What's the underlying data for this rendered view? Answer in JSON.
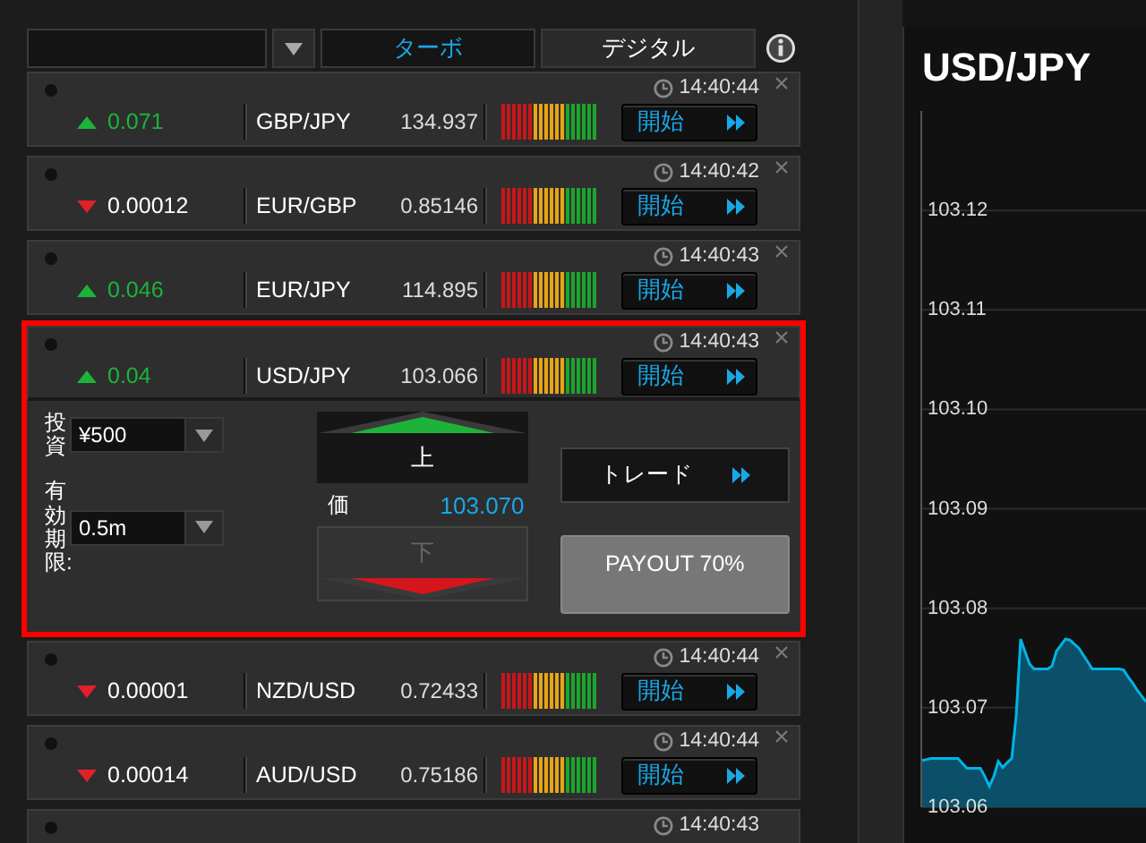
{
  "toolbar": {
    "tabs": [
      {
        "label": "ターボ",
        "selected": true
      },
      {
        "label": "デジタル",
        "selected": false
      }
    ]
  },
  "quotes": [
    {
      "kind": "quote",
      "rising": true,
      "change": "0.071",
      "pair": "GBP/JPY",
      "price": "134.937",
      "time": "14:40:44",
      "button": "開始",
      "expanded": false,
      "highlighted": false
    },
    {
      "kind": "quote",
      "rising": false,
      "change": "0.00012",
      "pair": "EUR/GBP",
      "price": "0.85146",
      "time": "14:40:42",
      "button": "開始",
      "expanded": false,
      "highlighted": false
    },
    {
      "kind": "quote",
      "rising": true,
      "change": "0.046",
      "pair": "EUR/JPY",
      "price": "114.895",
      "time": "14:40:43",
      "button": "開始",
      "expanded": false,
      "highlighted": false
    },
    {
      "kind": "quote",
      "rising": true,
      "change": "0.04",
      "pair": "USD/JPY",
      "price": "103.066",
      "time": "14:40:43",
      "button": "開始",
      "expanded": true,
      "highlighted": true
    },
    {
      "kind": "quote",
      "rising": false,
      "change": "0.00001",
      "pair": "NZD/USD",
      "price": "0.72433",
      "time": "14:40:44",
      "button": "開始",
      "expanded": false,
      "highlighted": false
    },
    {
      "kind": "quote",
      "rising": false,
      "change": "0.00014",
      "pair": "AUD/USD",
      "price": "0.75186",
      "time": "14:40:44",
      "button": "開始",
      "expanded": false,
      "highlighted": false
    },
    {
      "kind": "stub",
      "time": "14:40:43"
    }
  ],
  "order_panel": {
    "amount_label": "投資",
    "amount": "¥500",
    "expiry_label": "有効期限:",
    "expiry": "0.5m",
    "up": {
      "label": "上",
      "disabled": false
    },
    "price_label": "価",
    "price": "103.070",
    "down": {
      "label": "下",
      "disabled": true
    },
    "trade_button": "トレード",
    "payout": "PAYOUT 70%"
  },
  "chart": {
    "chart_data": {
      "type": "area",
      "title": "USD/JPY",
      "categories": [
        null,
        null,
        null,
        null,
        null,
        null,
        null,
        null,
        null,
        null,
        null,
        null,
        null,
        null,
        null,
        null,
        null,
        null,
        null,
        null,
        null,
        null,
        null,
        null,
        null,
        null,
        null,
        null,
        null,
        null,
        null,
        null,
        null,
        null,
        null,
        null,
        null,
        null,
        null,
        null,
        null,
        null,
        null,
        null,
        null,
        null,
        null,
        null,
        null,
        null,
        null
      ],
      "series": [
        {
          "color": "#00b4e6",
          "values": [
            103.0647,
            103.0648,
            103.0649,
            103.0649,
            103.0649,
            103.0649,
            103.0649,
            103.0649,
            103.0649,
            103.0644,
            103.0639,
            103.0639,
            103.0639,
            103.0639,
            103.0631,
            103.0621,
            103.0631,
            103.0646,
            103.064,
            103.0645,
            103.0649,
            103.0692,
            103.0769,
            103.0756,
            103.0744,
            103.0739,
            103.0739,
            103.0739,
            103.0739,
            103.0742,
            103.0757,
            103.0763,
            103.0769,
            103.0768,
            103.0764,
            103.076,
            103.0753,
            103.0746,
            103.0739,
            103.0739,
            103.0739,
            103.0739,
            103.0739,
            103.0739,
            103.0739,
            103.0738,
            103.0731,
            103.0725,
            103.0718,
            103.0712,
            103.0706
          ]
        }
      ],
      "ylim": [
        103.06,
        103.13
      ],
      "grid": true,
      "yticks": [
        {
          "value": 103.06,
          "label": "103.06"
        },
        {
          "value": 103.07,
          "label": "103.07"
        },
        {
          "value": 103.08,
          "label": "103.08"
        },
        {
          "value": 103.09,
          "label": "103.09"
        },
        {
          "value": 103.1,
          "label": "103.10"
        },
        {
          "value": 103.11,
          "label": "103.11"
        },
        {
          "value": 103.12,
          "label": "103.12"
        }
      ]
    }
  }
}
